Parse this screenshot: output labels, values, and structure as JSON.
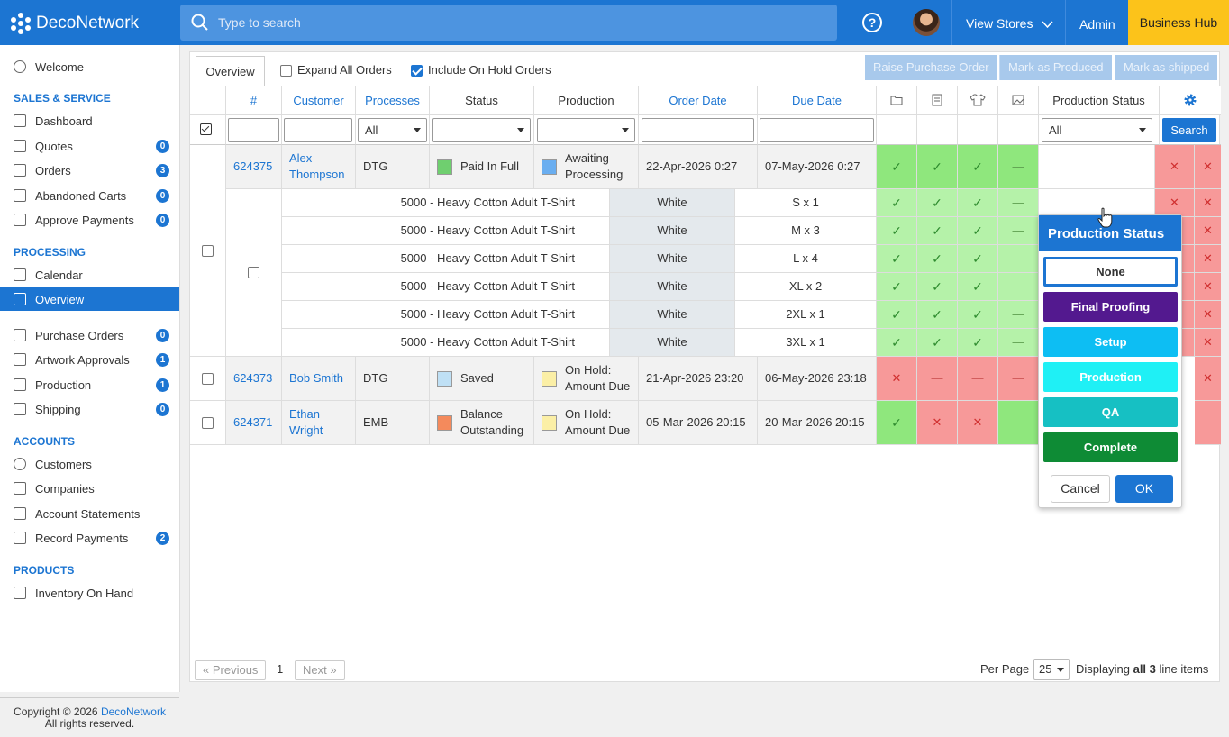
{
  "topbar": {
    "logo": "DecoNetwork",
    "search_placeholder": "Type to search",
    "help_label": "?",
    "view_stores": "View Stores",
    "admin": "Admin",
    "business_hub": "Business Hub"
  },
  "sidebar": {
    "welcome": "Welcome",
    "sections": [
      {
        "heading": "SALES & SERVICE",
        "items": [
          {
            "label": "Dashboard",
            "badge": ""
          },
          {
            "label": "Quotes",
            "badge": "0"
          },
          {
            "label": "Orders",
            "badge": "3"
          },
          {
            "label": "Abandoned Carts",
            "badge": "0"
          },
          {
            "label": "Approve Payments",
            "badge": "0"
          }
        ]
      },
      {
        "heading": "PROCESSING",
        "items": [
          {
            "label": "Calendar",
            "badge": ""
          },
          {
            "label": "Overview",
            "badge": ""
          },
          {
            "label": "Purchase Orders",
            "badge": "0"
          },
          {
            "label": "Artwork Approvals",
            "badge": "1"
          },
          {
            "label": "Production",
            "badge": "1"
          },
          {
            "label": "Shipping",
            "badge": "0"
          }
        ]
      },
      {
        "heading": "ACCOUNTS",
        "items": [
          {
            "label": "Customers",
            "badge": ""
          },
          {
            "label": "Companies",
            "badge": ""
          },
          {
            "label": "Account Statements",
            "badge": ""
          },
          {
            "label": "Record Payments",
            "badge": "2"
          }
        ]
      },
      {
        "heading": "PRODUCTS",
        "items": [
          {
            "label": "Inventory On Hand",
            "badge": ""
          }
        ]
      }
    ],
    "copyright_prefix": "Copyright © 2026 ",
    "copyright_link": "DecoNetwork",
    "copyright_suffix": "All rights reserved."
  },
  "toolbar": {
    "tab": "Overview",
    "expand_all": "Expand All Orders",
    "include_on_hold": "Include On Hold Orders",
    "raise_po": "Raise Purchase Order",
    "mark_produced": "Mark as Produced",
    "mark_shipped": "Mark as shipped"
  },
  "columns": {
    "num": "#",
    "customer": "Customer",
    "processes": "Processes",
    "status": "Status",
    "production": "Production",
    "order_date": "Order Date",
    "due_date": "Due Date",
    "production_status": "Production Status"
  },
  "filters": {
    "processes": "All",
    "production_status": "All",
    "search": "Search"
  },
  "orders": [
    {
      "id": "624375",
      "customer": "Alex Thompson",
      "process": "DTG",
      "status": "Paid In Full",
      "status_color": "#6fcf6f",
      "production": "Awaiting Processing",
      "production_color": "#6aaef0",
      "order_date": "22-Apr-2026 0:27",
      "due_date": "07-May-2026 0:27"
    },
    {
      "id": "624373",
      "customer": "Bob Smith",
      "process": "DTG",
      "status": "Saved",
      "status_color": "#bfe0f5",
      "production": "On Hold: Amount Due",
      "production_color": "#fbefa6",
      "order_date": "21-Apr-2026 23:20",
      "due_date": "06-May-2026 23:18"
    },
    {
      "id": "624371",
      "customer": "Ethan Wright",
      "process": "EMB",
      "status": "Balance Outstanding",
      "status_color": "#f48a5c",
      "production": "On Hold: Amount Due",
      "production_color": "#fbefa6",
      "order_date": "05-Mar-2026 20:15",
      "due_date": "20-Mar-2026 20:15"
    }
  ],
  "line_items": [
    {
      "product": "5000 - Heavy Cotton Adult T-Shirt",
      "color": "White",
      "size": "S x 1"
    },
    {
      "product": "5000 - Heavy Cotton Adult T-Shirt",
      "color": "White",
      "size": "M x 3"
    },
    {
      "product": "5000 - Heavy Cotton Adult T-Shirt",
      "color": "White",
      "size": "L x 4"
    },
    {
      "product": "5000 - Heavy Cotton Adult T-Shirt",
      "color": "White",
      "size": "XL x 2"
    },
    {
      "product": "5000 - Heavy Cotton Adult T-Shirt",
      "color": "White",
      "size": "2XL x 1"
    },
    {
      "product": "5000 - Heavy Cotton Adult T-Shirt",
      "color": "White",
      "size": "3XL x 1"
    }
  ],
  "popup": {
    "title": "Production Status",
    "options": [
      {
        "label": "None",
        "bg": "#ffffff",
        "fg": "#333333"
      },
      {
        "label": "Final Proofing",
        "bg": "#53198f",
        "fg": "#ffffff"
      },
      {
        "label": "Setup",
        "bg": "#0dbef3",
        "fg": "#ffffff"
      },
      {
        "label": "Production",
        "bg": "#1ff0f5",
        "fg": "#ffffff"
      },
      {
        "label": "QA",
        "bg": "#16c0c3",
        "fg": "#ffffff"
      },
      {
        "label": "Complete",
        "bg": "#0e8b35",
        "fg": "#ffffff"
      }
    ],
    "cancel": "Cancel",
    "ok": "OK"
  },
  "footer": {
    "previous": "« Previous",
    "page": "1",
    "next": "Next »",
    "per_page_label": "Per Page",
    "per_page": "25",
    "displaying_prefix": "Displaying ",
    "displaying_bold": "all 3",
    "displaying_suffix": " line items"
  }
}
